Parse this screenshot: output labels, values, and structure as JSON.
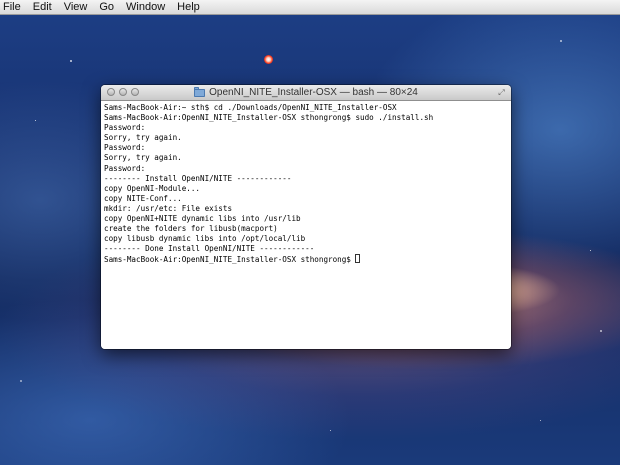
{
  "menubar": {
    "items": [
      "File",
      "Edit",
      "View",
      "Go",
      "Window",
      "Help"
    ]
  },
  "window": {
    "title": "OpenNI_NITE_Installer-OSX — bash — 80×24",
    "folder_icon": "folder-icon",
    "resize_icon": "fullscreen-arrows-icon"
  },
  "terminal": {
    "lines": [
      "Sams-MacBook-Air:~ sth$ cd ./Downloads/OpenNI_NITE_Installer-OSX",
      "Sams-MacBook-Air:OpenNI_NITE_Installer-OSX sthongrong$ sudo ./install.sh",
      "Password:",
      "Sorry, try again.",
      "Password:",
      "Sorry, try again.",
      "Password:",
      "-------- Install OpenNI/NITE ------------",
      "copy OpenNI-Module...",
      "copy NITE-Conf...",
      "mkdir: /usr/etc: File exists",
      "copy OpenNI+NITE dynamic libs into /usr/lib",
      "create the folders for libusb(macport)",
      "copy libusb dynamic libs into /opt/local/lib",
      "-------- Done Install OpenNI/NITE ------------"
    ],
    "prompt": "Sams-MacBook-Air:OpenNI_NITE_Installer-OSX sthongrong$"
  }
}
